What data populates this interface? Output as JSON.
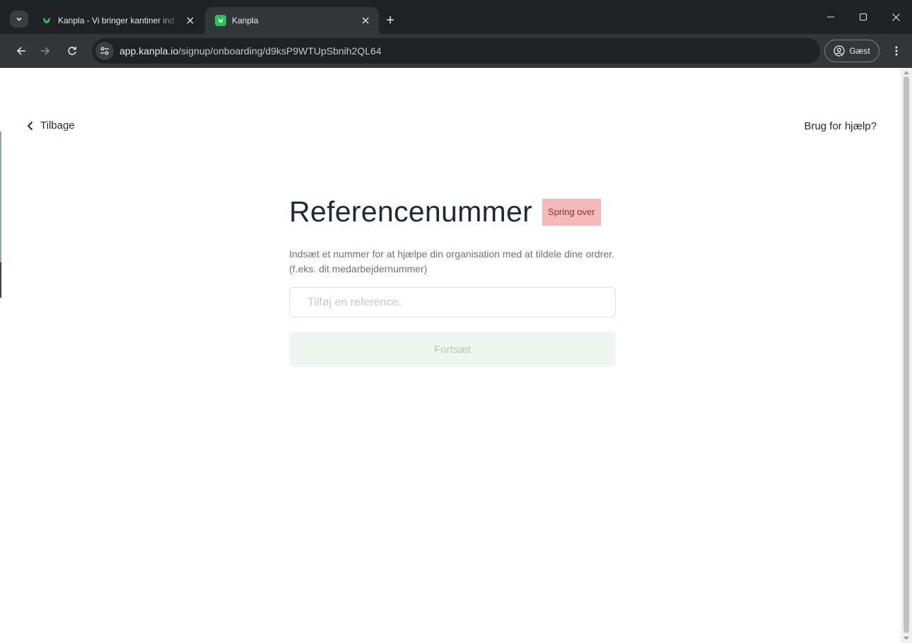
{
  "browser": {
    "tabs": [
      {
        "title": "Kanpla - Vi bringer kantiner ind",
        "active": false,
        "favicon": "kanpla-leaf-icon"
      },
      {
        "title": "Kanpla",
        "active": true,
        "favicon": "kanpla-logo-icon"
      }
    ],
    "url": {
      "host": "app.kanpla.io",
      "path": "/signup/onboarding/d9ksP9WTUpSbnih2QL64"
    },
    "profile_label": "Gæst"
  },
  "page": {
    "back_label": "Tilbage",
    "help_label": "Brug for hjælp?",
    "title": "Referencenummer",
    "skip_label": "Spring over",
    "description": "Indsæt et nummer for at hjælpe din organisation med at tildele dine ordrer. (f.eks. dit medarbejdernummer)",
    "input": {
      "placeholder": "Tilføj en reference.",
      "value": ""
    },
    "continue_label": "Fortsæt"
  },
  "colors": {
    "brand_green": "#2fbf5b",
    "skip_bg": "#f6b8b8",
    "continue_bg": "#eef7f1"
  }
}
